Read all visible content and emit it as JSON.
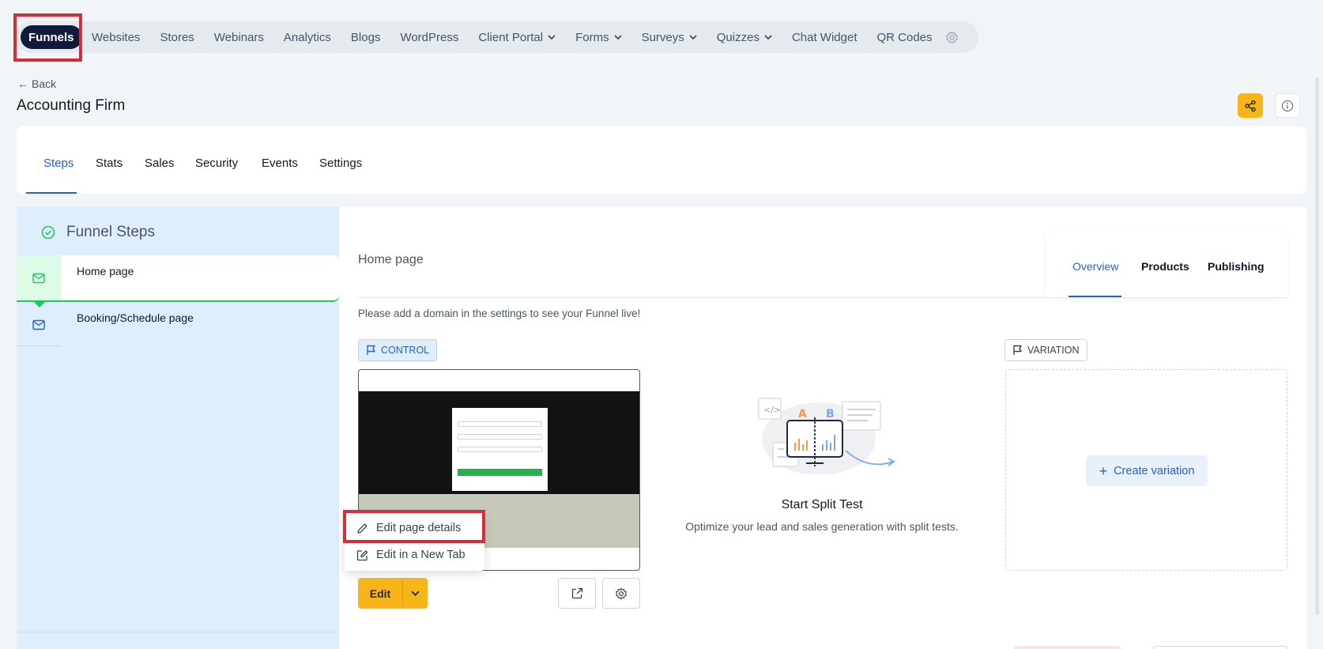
{
  "topnav": {
    "items": [
      {
        "label": "Funnels"
      },
      {
        "label": "Websites"
      },
      {
        "label": "Stores"
      },
      {
        "label": "Webinars"
      },
      {
        "label": "Analytics"
      },
      {
        "label": "Blogs"
      },
      {
        "label": "WordPress"
      },
      {
        "label": "Client Portal"
      },
      {
        "label": "Forms"
      },
      {
        "label": "Surveys"
      },
      {
        "label": "Quizzes"
      },
      {
        "label": "Chat Widget"
      },
      {
        "label": "QR Codes"
      }
    ],
    "settings_icon": "gear-icon"
  },
  "header": {
    "back_label": "Back",
    "title": "Accounting Firm"
  },
  "tabs": [
    {
      "label": "Steps"
    },
    {
      "label": "Stats"
    },
    {
      "label": "Sales"
    },
    {
      "label": "Security"
    },
    {
      "label": "Events"
    },
    {
      "label": "Settings"
    }
  ],
  "funnel_steps": {
    "title": "Funnel Steps",
    "steps": [
      {
        "label": "Home page"
      },
      {
        "label": "Booking/Schedule page"
      }
    ]
  },
  "page": {
    "title": "Home page",
    "subtabs": [
      {
        "label": "Overview"
      },
      {
        "label": "Products"
      },
      {
        "label": "Publishing"
      }
    ],
    "notice": "Please add a domain in the settings to see your Funnel live!",
    "control_label": "CONTROL",
    "variation_label": "VARIATION",
    "edit_label": "Edit",
    "menu": {
      "edit_details": "Edit page details",
      "edit_new_tab": "Edit in a New Tab"
    },
    "split_test": {
      "title": "Start Split Test",
      "description": "Optimize your lead and sales generation with split tests."
    },
    "create_variation": "Create variation"
  },
  "colors": {
    "accent_blue": "#2563c9",
    "edit_yellow": "#f7b519",
    "nav_active": "#101a3b",
    "highlight_red": "#d32f3a",
    "success_green": "#22c55e"
  }
}
